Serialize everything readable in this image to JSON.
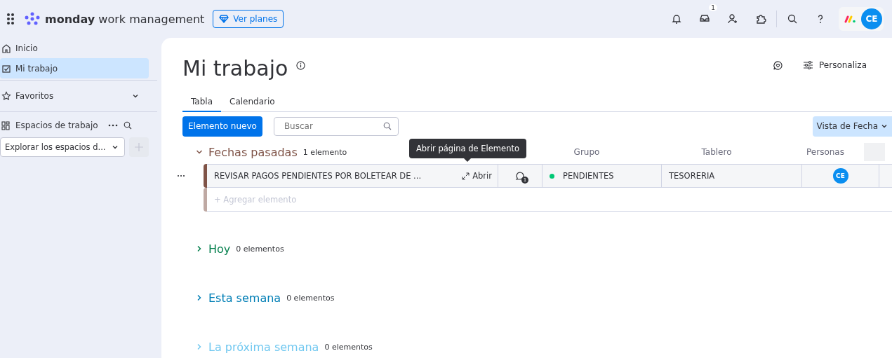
{
  "topbar": {
    "brand_bold": "monday",
    "brand_rest": "work management",
    "plans_button": "Ver planes",
    "inbox_badge": "1",
    "avatar": "CE"
  },
  "sidebar": {
    "items": [
      {
        "label": "Inicio",
        "selected": false
      },
      {
        "label": "Mi trabajo",
        "selected": true
      }
    ],
    "favorites": {
      "label": "Favoritos",
      "expanded": false
    },
    "workspaces": {
      "title": "Espacios de trabajo",
      "dropdown": "Explorar los espacios d..."
    }
  },
  "page": {
    "title": "Mi trabajo",
    "customize": "Personaliza",
    "tabs": [
      {
        "label": "Tabla",
        "selected": true
      },
      {
        "label": "Calendario",
        "selected": false
      }
    ],
    "new_button": "Elemento nuevo",
    "search": {
      "placeholder": "Buscar"
    },
    "view_button": "Vista de Fecha"
  },
  "table": {
    "columns": [
      "Grupo",
      "Tablero",
      "Personas"
    ],
    "groups": [
      {
        "title": "Fechas pasadas",
        "count": "1 elemento",
        "color": "#7f5347",
        "expanded": true,
        "rows": [
          {
            "name": "REVISAR PAGOS PENDIENTES POR BOLETEAR DE ...",
            "open": "Abrir",
            "open_tooltip": "Abrir página de Elemento",
            "updates": "1",
            "group": "PENDIENTES",
            "color": "#00c875",
            "board": "TESORERIA",
            "person": "CE"
          }
        ],
        "add_placeholder": "+ Agregar elemento"
      },
      {
        "title": "Hoy",
        "count": "0 elementos",
        "color": "#037f4c",
        "expanded": false
      },
      {
        "title": "Esta semana",
        "count": "0 elementos",
        "color": "#007eb5",
        "expanded": false
      },
      {
        "title": "La próxima semana",
        "count": "0 elementos",
        "color": "#71c8f0",
        "expanded": false
      }
    ]
  }
}
